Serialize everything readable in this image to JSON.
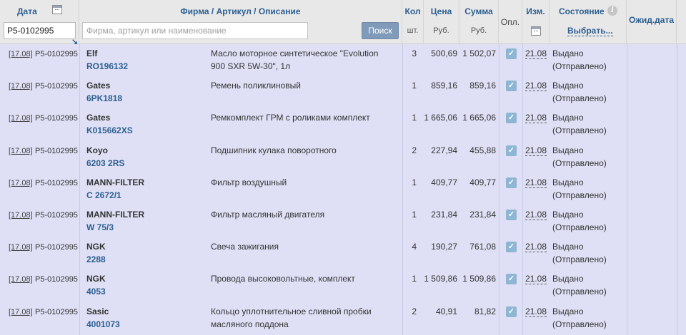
{
  "header": {
    "date": "Дата",
    "firm": "Фирма / Артикул / Описание",
    "qty": "Кол",
    "qty_unit": "шт.",
    "price": "Цена",
    "price_unit": "Руб.",
    "sum": "Сумма",
    "sum_unit": "Руб.",
    "paid": "Опл.",
    "changed": "Изм.",
    "status": "Состояние",
    "status_choose": "Выбрать...",
    "expected": "Ожид.дата"
  },
  "filters": {
    "date_value": "P5-0102995",
    "search_placeholder": "Фирма, артикул или наименование",
    "search_button": "Поиск"
  },
  "icons": {
    "date_calendar": "calendar-icon",
    "changed_calendar": "calendar-icon",
    "status_info": "info-icon",
    "paid_check": "checkmark-icon",
    "sort": "sort-arrow-icon"
  },
  "colors": {
    "header_bg": "#e8e8e8",
    "body_bg": "#dfe0f5",
    "accent": "#2c5f91",
    "search_button": "#7f9bb9",
    "checkbox": "#8eb6d3"
  },
  "rows": [
    {
      "date": "[17.08]",
      "order": "P5-0102995",
      "brand": "Elf",
      "article": "RO196132",
      "desc1": "Масло моторное синтетическое \"Evolution",
      "desc2": "900 SXR 5W-30\", 1л",
      "qty": "3",
      "price": "500,69",
      "sum": "1 502,07",
      "changed": "21.08",
      "status1": "Выдано",
      "status2": "(Отправлено)"
    },
    {
      "date": "[17.08]",
      "order": "P5-0102995",
      "brand": "Gates",
      "article": "6PK1818",
      "desc1": "Ремень поликлиновый",
      "desc2": "",
      "qty": "1",
      "price": "859,16",
      "sum": "859,16",
      "changed": "21.08",
      "status1": "Выдано",
      "status2": "(Отправлено)"
    },
    {
      "date": "[17.08]",
      "order": "P5-0102995",
      "brand": "Gates",
      "article": "K015662XS",
      "desc1": "Ремкомплект ГРМ с роликами комплект",
      "desc2": "",
      "qty": "1",
      "price": "1 665,06",
      "sum": "1 665,06",
      "changed": "21.08",
      "status1": "Выдано",
      "status2": "(Отправлено)"
    },
    {
      "date": "[17.08]",
      "order": "P5-0102995",
      "brand": "Koyo",
      "article": "6203 2RS",
      "desc1": "Подшипник кулака поворотного",
      "desc2": "",
      "qty": "2",
      "price": "227,94",
      "sum": "455,88",
      "changed": "21.08",
      "status1": "Выдано",
      "status2": "(Отправлено)"
    },
    {
      "date": "[17.08]",
      "order": "P5-0102995",
      "brand": "MANN-FILTER",
      "article": "C 2672/1",
      "desc1": "Фильтр воздушный",
      "desc2": "",
      "qty": "1",
      "price": "409,77",
      "sum": "409,77",
      "changed": "21.08",
      "status1": "Выдано",
      "status2": "(Отправлено)"
    },
    {
      "date": "[17.08]",
      "order": "P5-0102995",
      "brand": "MANN-FILTER",
      "article": "W 75/3",
      "desc1": "Фильтр масляный двигателя",
      "desc2": "",
      "qty": "1",
      "price": "231,84",
      "sum": "231,84",
      "changed": "21.08",
      "status1": "Выдано",
      "status2": "(Отправлено)"
    },
    {
      "date": "[17.08]",
      "order": "P5-0102995",
      "brand": "NGK",
      "article": "2288",
      "desc1": "Свеча зажигания",
      "desc2": "",
      "qty": "4",
      "price": "190,27",
      "sum": "761,08",
      "changed": "21.08",
      "status1": "Выдано",
      "status2": "(Отправлено)"
    },
    {
      "date": "[17.08]",
      "order": "P5-0102995",
      "brand": "NGK",
      "article": "4053",
      "desc1": "Провода высоковольтные, комплект",
      "desc2": "",
      "qty": "1",
      "price": "1 509,86",
      "sum": "1 509,86",
      "changed": "21.08",
      "status1": "Выдано",
      "status2": "(Отправлено)"
    },
    {
      "date": "[17.08]",
      "order": "P5-0102995",
      "brand": "Sasic",
      "article": "4001073",
      "desc1": "Кольцо уплотнительное сливной пробки",
      "desc2": "масляного поддона",
      "qty": "2",
      "price": "40,91",
      "sum": "81,82",
      "changed": "21.08",
      "status1": "Выдано",
      "status2": "(Отправлено)"
    }
  ]
}
